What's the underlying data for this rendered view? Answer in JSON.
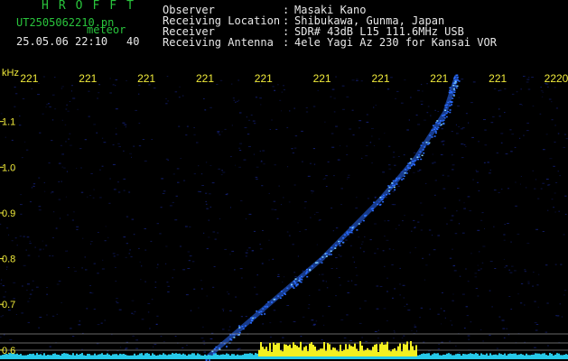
{
  "header": {
    "title": "HROFFT",
    "filename": "UT2505062210.pn",
    "meteor_tag": "meteor",
    "timestamp": "25.05.06 22:10",
    "count": "40",
    "fields": [
      {
        "label": "Observer",
        "sep": ":",
        "value": "Masaki Kano"
      },
      {
        "label": "Receiving Location",
        "sep": ":",
        "value": "Shibukawa, Gunma, Japan"
      },
      {
        "label": "Receiver",
        "sep": ":",
        "value": "SDR# 43dB L15 111.6MHz USB"
      },
      {
        "label": "Receiving Antenna",
        "sep": ":",
        "value": "4ele Yagi Az 230 for Kansai VOR"
      }
    ]
  },
  "colors": {
    "background": "#000000",
    "header_green": "#29c43c",
    "header_white": "#e8e8e8",
    "axis_yellow": "#f0ea3a",
    "echo_blue": "#2a6cff",
    "noise_blue": "#1a2a9a",
    "spectrum_cyan": "#26c8e8",
    "spectrum_yellow": "#f4f020"
  },
  "chart_data": {
    "type": "heatmap",
    "ylabel": "kHz",
    "yticks": [
      "1.1",
      "1.0",
      "0.9",
      "0.8",
      "0.7",
      "0.6"
    ],
    "ytick_values": [
      1.1,
      1.0,
      0.9,
      0.8,
      0.7,
      0.6
    ],
    "ylim": [
      0.58,
      1.2
    ],
    "xticks": [
      "221",
      "221",
      "221",
      "221",
      "221",
      "221",
      "221",
      "221",
      "221",
      "2220"
    ],
    "xtick_values": [
      2211,
      2212,
      2213,
      2214,
      2215,
      2216,
      2217,
      2218,
      2219,
      2220
    ],
    "xlim": [
      2210.5,
      2220.2
    ],
    "meteor_trace": {
      "x": [
        2214.0,
        2215.0,
        2216.0,
        2217.0,
        2217.6,
        2218.1,
        2218.3
      ],
      "y": [
        0.58,
        0.69,
        0.8,
        0.93,
        1.02,
        1.12,
        1.2
      ]
    },
    "spectrum_strip": {
      "baseline_cyan": true,
      "strong_band_x": [
        2214.9,
        2217.6
      ]
    }
  }
}
